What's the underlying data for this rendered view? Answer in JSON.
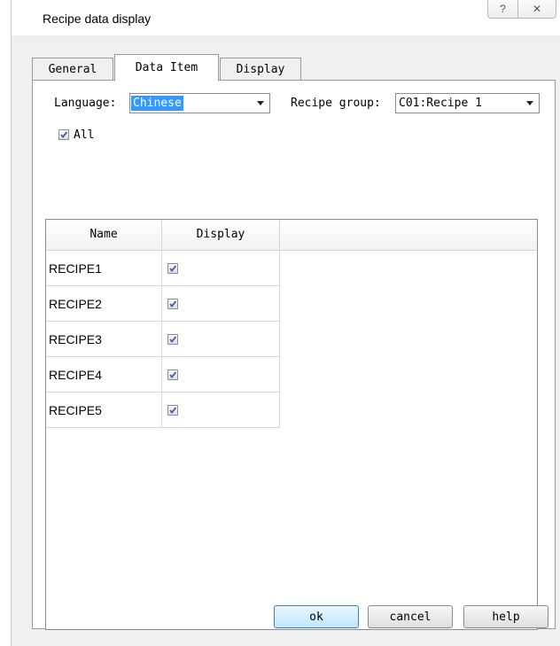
{
  "window": {
    "title": "Recipe data display",
    "help_glyph": "?",
    "close_glyph": "✕"
  },
  "tabs": [
    {
      "label": "General"
    },
    {
      "label": "Data Item"
    },
    {
      "label": "Display"
    }
  ],
  "filters": {
    "language_label": "Language:",
    "language_value": "Chinese",
    "recipe_group_label": "Recipe group:",
    "recipe_group_value": "C01:Recipe 1",
    "all_label": "All",
    "all_checked": true
  },
  "table": {
    "columns": [
      "Name",
      "Display"
    ],
    "rows": [
      {
        "name": "RECIPE1",
        "display": true
      },
      {
        "name": "RECIPE2",
        "display": true
      },
      {
        "name": "RECIPE3",
        "display": true
      },
      {
        "name": "RECIPE4",
        "display": true
      },
      {
        "name": "RECIPE5",
        "display": true
      }
    ]
  },
  "buttons": {
    "ok": "ok",
    "cancel": "cancel",
    "help": "help"
  },
  "icons": {
    "checkbox_check": "checkmark-icon",
    "dropdown": "chevron-down-icon",
    "help": "question-icon",
    "close": "close-icon"
  }
}
